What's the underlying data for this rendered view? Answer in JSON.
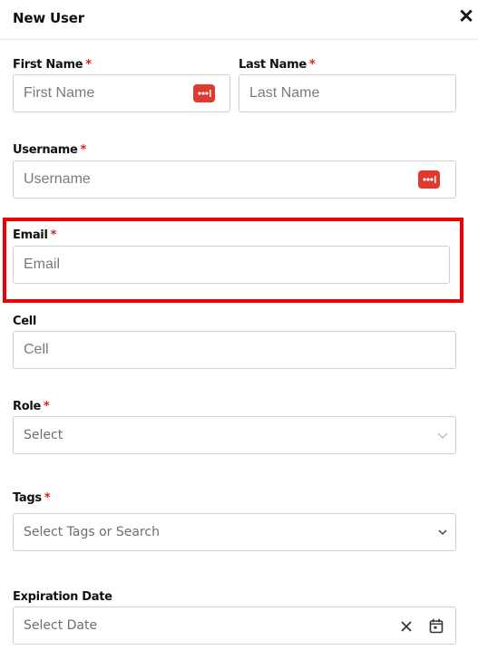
{
  "header": {
    "title": "New User",
    "close_icon": "close-icon"
  },
  "form": {
    "required_marker": "*",
    "first_name": {
      "label": "First Name",
      "placeholder": "First Name",
      "value": ""
    },
    "last_name": {
      "label": "Last Name",
      "placeholder": "Last Name",
      "value": ""
    },
    "username": {
      "label": "Username",
      "placeholder": "Username",
      "value": ""
    },
    "email": {
      "label": "Email",
      "placeholder": "Email",
      "value": ""
    },
    "cell": {
      "label": "Cell",
      "placeholder": "Cell",
      "value": ""
    },
    "role": {
      "label": "Role",
      "selected": "Select"
    },
    "tags": {
      "label": "Tags",
      "selected": "Select Tags or Search"
    },
    "expiration_date": {
      "label": "Expiration Date",
      "placeholder": "Select Date"
    }
  },
  "colors": {
    "required": "#e0201b",
    "highlight": "#ee0000",
    "password_manager_icon": "#e03a2e"
  }
}
